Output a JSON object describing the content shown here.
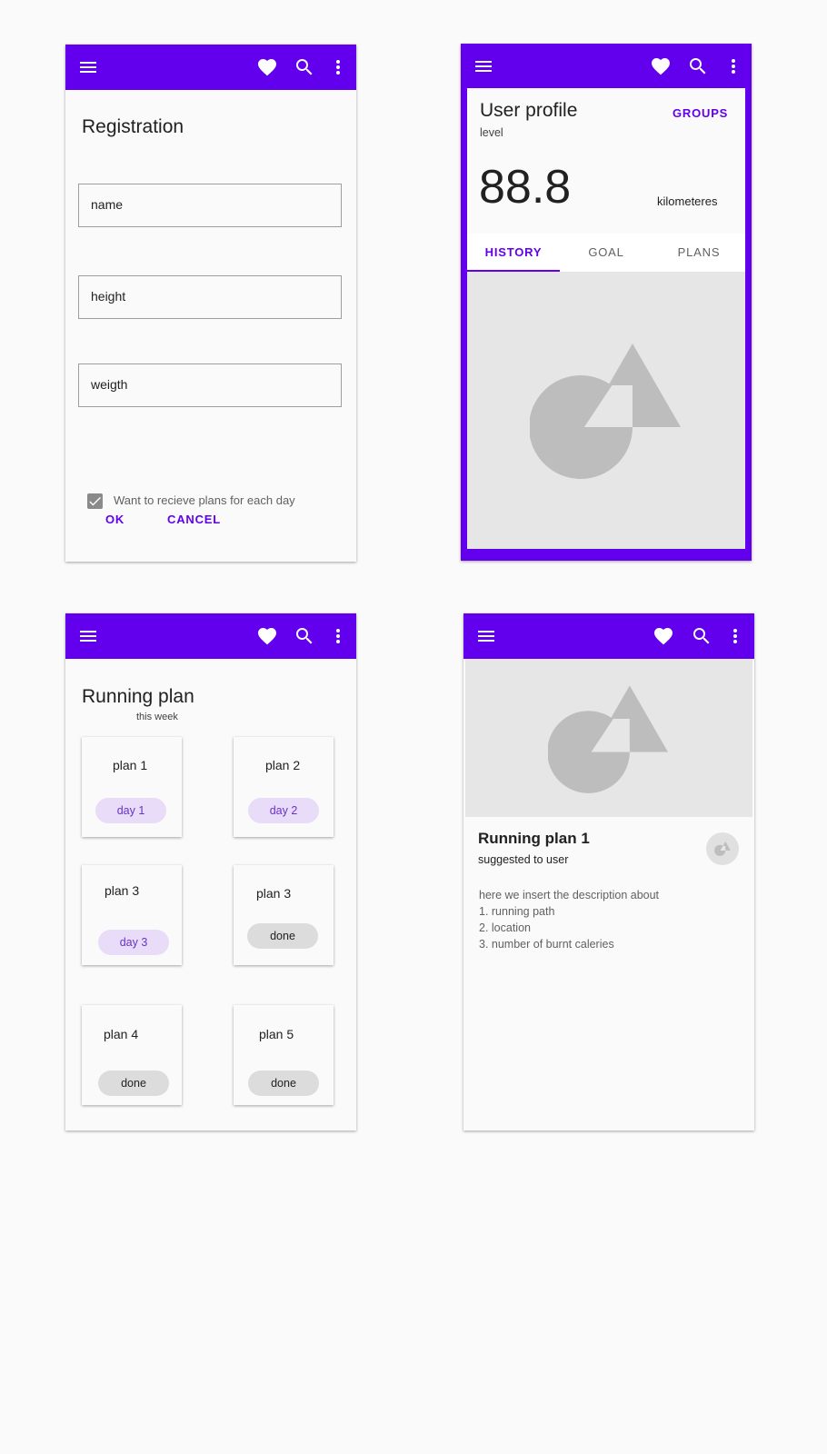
{
  "colors": {
    "primary": "#6200ee",
    "surface": "#fafafa",
    "media": "#e6e6e6",
    "chip_day": "#e8dcf8",
    "chip_done": "#dcdcdc"
  },
  "icons": {
    "menu": "menu-icon",
    "favorite": "heart-icon",
    "search": "search-icon",
    "more": "more-vert-icon",
    "image": "image-placeholder-icon"
  },
  "registration": {
    "title": "Registration",
    "fields": [
      "name",
      "height",
      "weigth"
    ],
    "checkbox_label": "Want to recieve plans for each day",
    "checkbox_checked": true,
    "ok": "OK",
    "cancel": "CANCEL"
  },
  "profile": {
    "title": "User profile",
    "subtitle": "level",
    "groups": "GROUPS",
    "value": "88.8",
    "unit": "kilometeres",
    "tabs": [
      "HISTORY",
      "GOAL",
      "PLANS"
    ],
    "active_tab": "HISTORY"
  },
  "running_plan": {
    "title": "Running plan",
    "subtitle": "this week",
    "cards": [
      {
        "name": "plan 1",
        "status": "day 1"
      },
      {
        "name": "plan 2",
        "status": "day 2"
      },
      {
        "name": "plan 3",
        "status": "day 3"
      },
      {
        "name": "plan 3",
        "status": "done"
      },
      {
        "name": "plan 4",
        "status": "done"
      },
      {
        "name": "plan 5",
        "status": "done"
      }
    ]
  },
  "plan_detail": {
    "title": "Running plan 1",
    "subtitle": "suggested to user",
    "description": [
      "here we insert the description about",
      "1. running path",
      "2. location",
      "3. number of burnt caleries"
    ]
  }
}
